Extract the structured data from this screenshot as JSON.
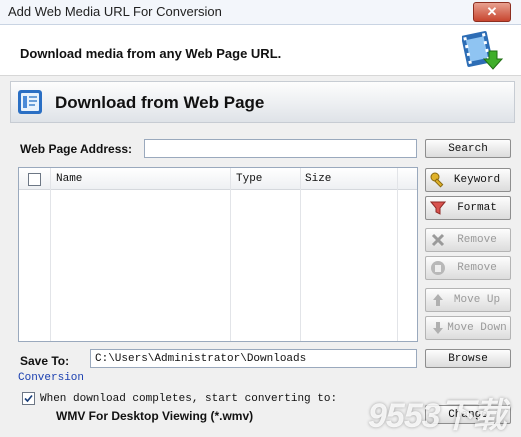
{
  "window": {
    "title": "Add Web Media URL For Conversion",
    "close_glyph": "✕"
  },
  "banner": {
    "text": "Download media from any Web Page URL.",
    "icon": "film-download-icon"
  },
  "section": {
    "title": "Download from Web Page",
    "icon": "web-page-icon"
  },
  "address": {
    "label": "Web Page Address:",
    "value": "",
    "placeholder": ""
  },
  "buttons": {
    "search": "Search",
    "keyword": "Keyword",
    "format": "Format",
    "remove": "Remove",
    "remove_all": "Remove",
    "move_up": "Move Up",
    "move_down": "Move Down",
    "browse": "Browse",
    "change": "Change"
  },
  "table": {
    "columns": [
      "Name",
      "Type",
      "Size"
    ],
    "rows": []
  },
  "save": {
    "label": "Save To:",
    "path": "C:\\Users\\Administrator\\Downloads"
  },
  "conversion": {
    "link": "Conversion",
    "checkbox_checked": true,
    "checkbox_label": "When download completes, start converting to:",
    "format": "WMV For Desktop Viewing (*.wmv)"
  },
  "watermark": "9553下载",
  "colors": {
    "link": "#1a3fb0",
    "close": "#c7452f"
  }
}
